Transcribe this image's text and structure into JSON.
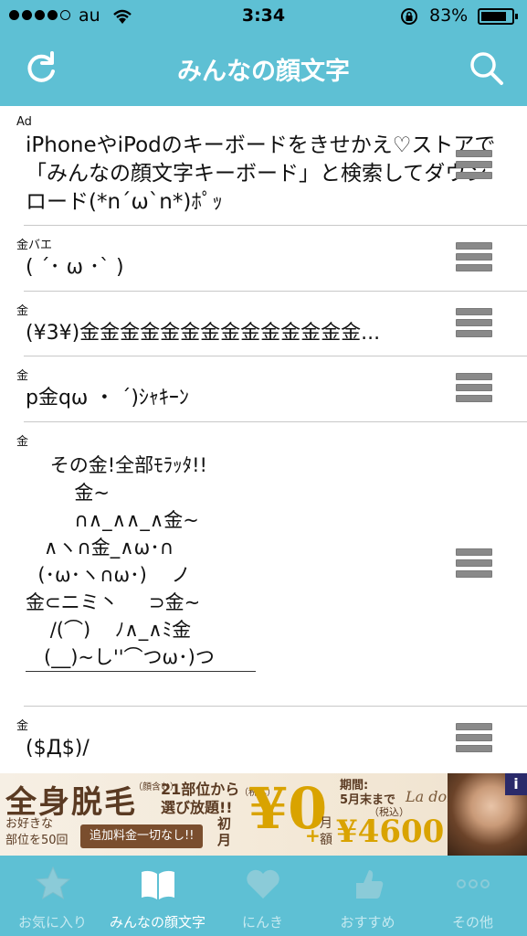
{
  "status_bar": {
    "carrier": "au",
    "time": "3:34",
    "battery_percent": "83%",
    "battery_level": 0.83
  },
  "navbar": {
    "title": "みんなの顔文字",
    "left_icon": "refresh-icon",
    "right_icon": "search-icon"
  },
  "list": {
    "rows": [
      {
        "category": "Ad",
        "text": "iPhoneやiPodのキーボードをきせかえ♡ストアで「みんなの顔文字キーボード」と検索してダウンロード(*n´ω`n*)ﾎﾟｯ"
      },
      {
        "category": "金バエ",
        "text": "( ´･ ω ･` )"
      },
      {
        "category": "金",
        "text": "(¥3¥)金金金金金金金金金金金金金金..."
      },
      {
        "category": "金",
        "text": "p金qω ・ ´)ｼｬｷｰﾝ"
      },
      {
        "category": "金",
        "text": "    その金!全部ﾓﾗｯﾀ!!\n        金~\n        ∩∧_∧∧_∧金~\n   ∧ヽ∩金_∧ω･∩\n  (･ω･ヽ∩ω･)    ノ\n金⊂ニミ丶     ⊃金~\n    /(⌒)    ﾉ∧_∧ﾐ金\n   (__)~し''⌒つω･)つ"
      },
      {
        "category": "金",
        "text": "($Д$)/"
      }
    ]
  },
  "banner": {
    "headline": "全身脱毛",
    "note_paren": "（顔含む）",
    "parts": "21部位から",
    "choose": "選び放題!!",
    "favorite": "お好きな",
    "parts50": "部位を50回",
    "no_fee": "追加料金一切なし!!",
    "first_month": "初月",
    "tax1": "（税込）",
    "price_first": "¥0",
    "plus": "+",
    "monthly": "月額",
    "period": "期間:",
    "until": "5月末まで",
    "tax2": "（税込）",
    "price_monthly": "¥4600",
    "brand": "La dolce",
    "info": "i"
  },
  "tabbar": {
    "tabs": [
      {
        "label": "お気に入り",
        "icon": "star-icon",
        "active": false
      },
      {
        "label": "みんなの顔文字",
        "icon": "book-icon",
        "active": true
      },
      {
        "label": "にんき",
        "icon": "heart-icon",
        "active": false
      },
      {
        "label": "おすすめ",
        "icon": "thumbs-up-icon",
        "active": false
      },
      {
        "label": "その他",
        "icon": "more-icon",
        "active": false
      }
    ]
  },
  "colors": {
    "accent": "#5ec0d4",
    "banner_gold": "#d9a300"
  }
}
